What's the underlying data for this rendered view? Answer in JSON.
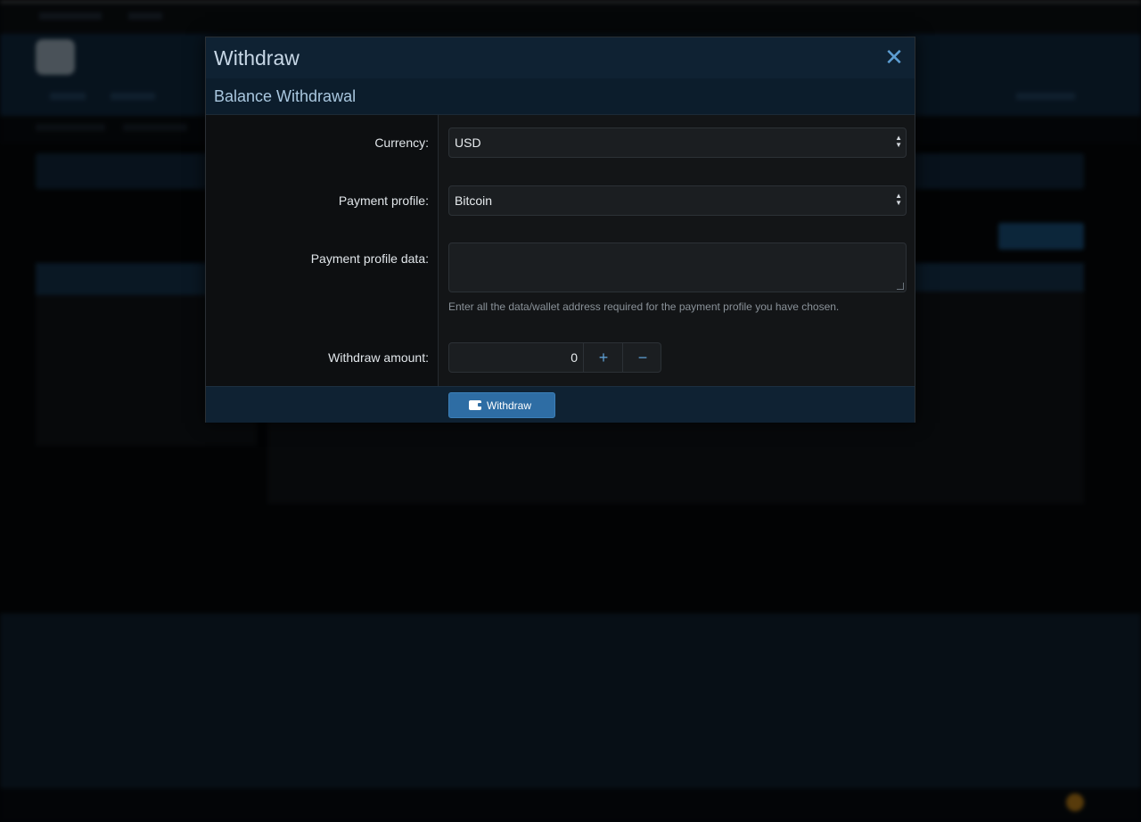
{
  "colors": {
    "accent": "#2e6da4",
    "modal_header_bg": "#0f2233",
    "page_bg": "#050709"
  },
  "modal": {
    "title": "Withdraw",
    "close_symbol": "✕",
    "section_title": "Balance Withdrawal",
    "fields": {
      "currency_label": "Currency:",
      "currency_value": "USD",
      "payment_profile_label": "Payment profile:",
      "payment_profile_value": "Bitcoin",
      "payment_profile_data_label": "Payment profile data:",
      "payment_profile_data_value": "",
      "payment_profile_data_hint": "Enter all the data/wallet address required for the payment profile you have chosen.",
      "amount_label": "Withdraw amount:",
      "amount_value": "0",
      "increment_symbol": "+",
      "decrement_symbol": "−"
    },
    "submit_label": "Withdraw",
    "submit_icon": "wallet-icon"
  }
}
